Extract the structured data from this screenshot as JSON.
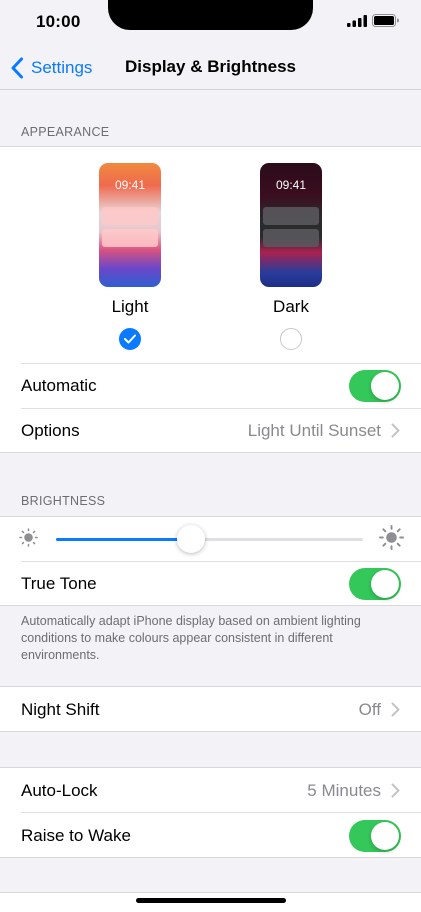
{
  "status_bar": {
    "time": "10:00"
  },
  "nav": {
    "back_label": "Settings",
    "title": "Display & Brightness"
  },
  "appearance": {
    "header": "APPEARANCE",
    "light": {
      "time": "09:41",
      "label": "Light",
      "selected": true
    },
    "dark": {
      "time": "09:41",
      "label": "Dark",
      "selected": false
    },
    "automatic_label": "Automatic",
    "automatic_on": true,
    "options_label": "Options",
    "options_value": "Light Until Sunset"
  },
  "brightness": {
    "header": "BRIGHTNESS",
    "level": 0.44,
    "true_tone_label": "True Tone",
    "true_tone_on": true,
    "footer": "Automatically adapt iPhone display based on ambient lighting conditions to make colours appear consistent in different environments."
  },
  "night_shift": {
    "label": "Night Shift",
    "value": "Off"
  },
  "lock": {
    "auto_lock_label": "Auto-Lock",
    "auto_lock_value": "5 Minutes",
    "raise_to_wake_label": "Raise to Wake",
    "raise_to_wake_on": true
  },
  "colors": {
    "accent": "#0a7aff",
    "toggle_on": "#34c759"
  }
}
